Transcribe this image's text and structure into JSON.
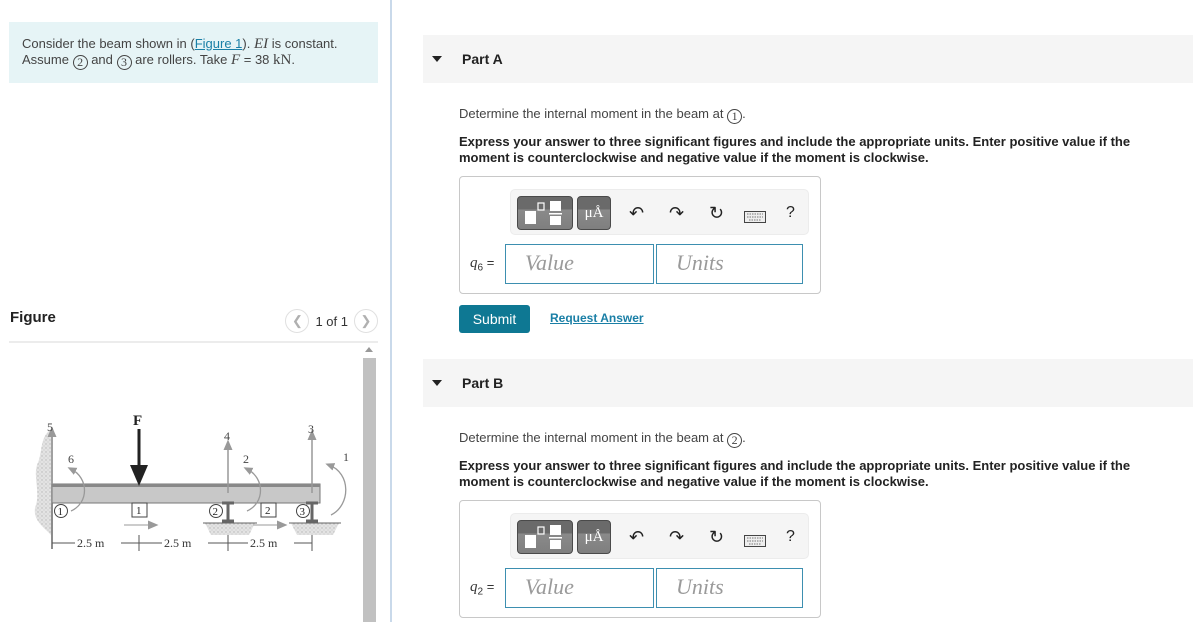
{
  "problem": {
    "text_1": "Consider the beam shown in (",
    "figure_link": "Figure 1",
    "text_2": "). ",
    "ei": "EI",
    "text_3": " is constant.",
    "text_4": "Assume ",
    "node_a": "2",
    "text_5": " and ",
    "node_b": "3",
    "text_6": " are rollers. Take ",
    "force_var": "F",
    "text_7": " = 38 ",
    "unit": "kN",
    "text_8": "."
  },
  "figure": {
    "title": "Figure",
    "pager": "1 of 1",
    "prev_icon": "chevron-left-icon",
    "next_icon": "chevron-right-icon",
    "diagram": {
      "force_label": "F",
      "reaction_labels": [
        "5",
        "6",
        "4",
        "2",
        "3",
        "1"
      ],
      "node_labels": [
        "1",
        "2",
        "3"
      ],
      "section_labels": [
        "1",
        "2"
      ],
      "spans": [
        "2.5 m",
        "2.5 m",
        "2.5 m"
      ]
    }
  },
  "parts": [
    {
      "label": "Part A",
      "question": "Determine the internal moment in the beam at ",
      "node": "1",
      "instruction": "Express your answer to three significant figures and include the appropriate units. Enter positive value if the moment is counterclockwise and negative value if the moment is clockwise.",
      "var_base": "q",
      "var_sub": "6",
      "equals": "=",
      "value_placeholder": "Value",
      "units_placeholder": "Units",
      "toolbar": {
        "unit_btn": "μÅ",
        "undo_icon": "undo-icon",
        "redo_icon": "redo-icon",
        "reset_icon": "reset-icon",
        "keyboard_icon": "keyboard-icon",
        "help": "?"
      },
      "submit_label": "Submit",
      "request_label": "Request Answer"
    },
    {
      "label": "Part B",
      "question": "Determine the internal moment in the beam at ",
      "node": "2",
      "instruction": "Express your answer to three significant figures and include the appropriate units. Enter positive value if the moment is counterclockwise and negative value if the moment is clockwise.",
      "var_base": "q",
      "var_sub": "2",
      "equals": "=",
      "value_placeholder": "Value",
      "units_placeholder": "Units",
      "toolbar": {
        "unit_btn": "μÅ",
        "undo_icon": "undo-icon",
        "redo_icon": "redo-icon",
        "reset_icon": "reset-icon",
        "keyboard_icon": "keyboard-icon",
        "help": "?"
      }
    }
  ],
  "colors": {
    "intro_bg": "#e6f4f6",
    "link": "#1a7fa6",
    "submit_bg": "#0e7893",
    "input_border": "#3d8fb0"
  }
}
